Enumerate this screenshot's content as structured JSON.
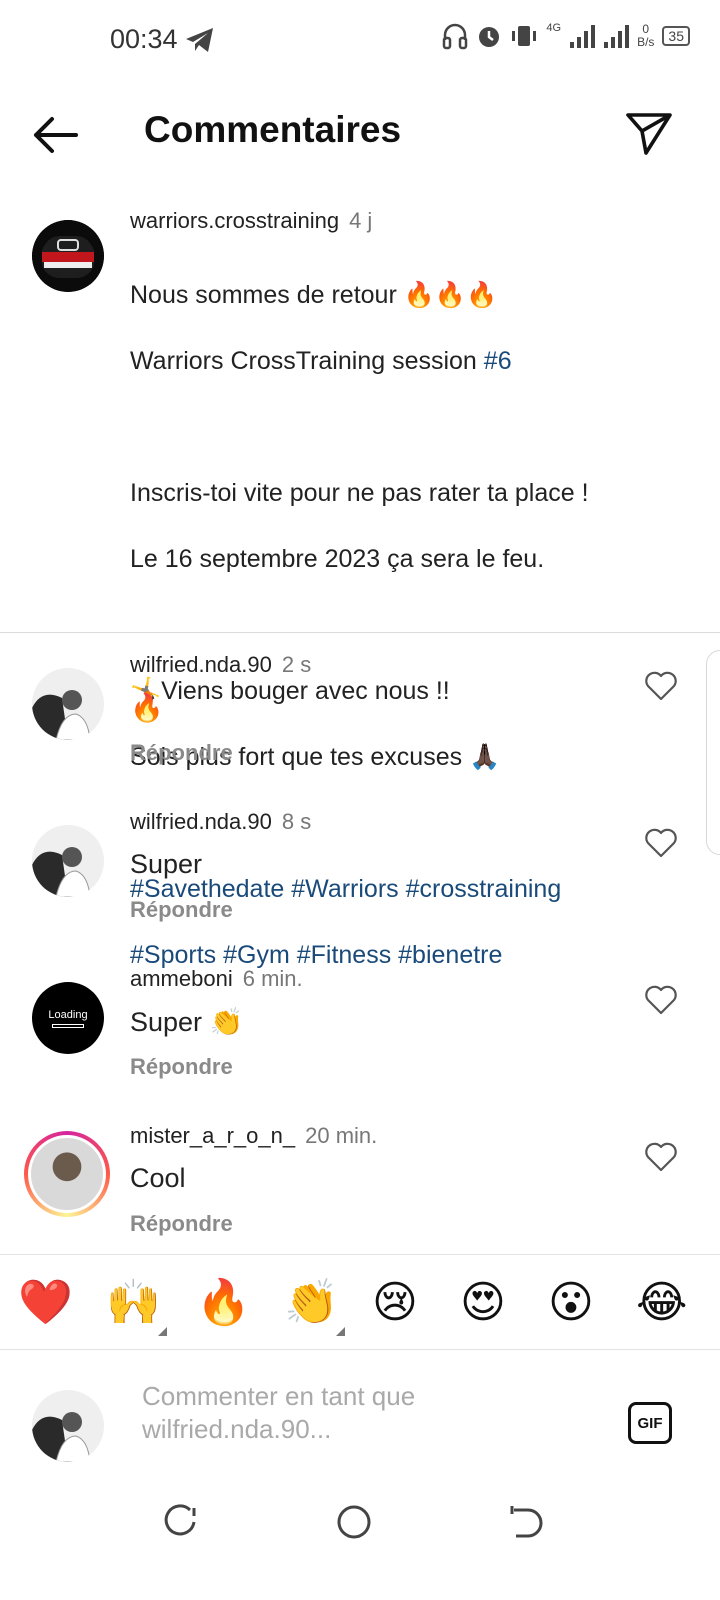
{
  "status": {
    "time": "00:34",
    "network": "4G",
    "net_speed_value": "0",
    "net_speed_unit": "B/s",
    "battery": "35"
  },
  "header": {
    "title": "Commentaires"
  },
  "post": {
    "username": "warriors.crosstraining",
    "time": "4 j",
    "caption_line1": "Nous sommes de retour 🔥🔥🔥",
    "caption_line2_text": "Warriors CrossTraining session ",
    "caption_line2_tag": "#6",
    "caption_line3": "Inscris-toi vite pour ne pas rater ta place !",
    "caption_line4": "Le 16 septembre 2023 ça sera le feu.",
    "caption_line5": "🤸Viens bouger avec nous !!",
    "caption_line6": "Sois plus fort que tes excuses 🙏🏿",
    "hashtags_line1": "#Savethedate #Warriors #crosstraining",
    "hashtags_line2": "#Sports #Gym #Fitness #bienetre",
    "avatar_text_top": "WARRIORS",
    "avatar_text_bottom": "CROSS TRAINING"
  },
  "comments": [
    {
      "username": "wilfried.nda.90",
      "time": "2 s",
      "text": "🔥",
      "reply": "Répondre"
    },
    {
      "username": "wilfried.nda.90",
      "time": "8 s",
      "text": "Super",
      "reply": "Répondre"
    },
    {
      "username": "ammeboni",
      "time": "6 min.",
      "text": "Super 👏",
      "reply": "Répondre",
      "avatar_text": "Loading"
    },
    {
      "username": "mister_a_r_o_n_",
      "time": "20 min.",
      "text": "Cool",
      "reply": "Répondre"
    }
  ],
  "emoji_bar": [
    "❤️",
    "🙌",
    "🔥",
    "👏",
    "😢",
    "😍",
    "😮",
    "😂"
  ],
  "composer": {
    "placeholder": "Commenter en tant que wilfried.nda.90...",
    "gif_label": "GIF"
  },
  "icons": {
    "back": "arrow-left-icon",
    "share": "send-icon",
    "like": "heart-outline-icon",
    "nav_recent": "recent-apps-icon",
    "nav_home": "home-circle-icon",
    "nav_back": "back-nav-icon"
  }
}
